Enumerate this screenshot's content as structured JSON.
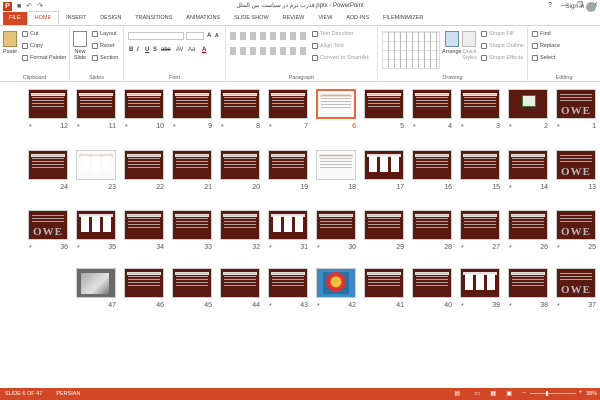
{
  "window": {
    "title": "قدرت نرم در سیاست بین الملل.pptx - PowerPoint",
    "min_glyph": "—",
    "restore_glyph": "❐",
    "close_glyph": "✕",
    "help_glyph": "?",
    "qat_undo": "↶",
    "qat_redo": "↷",
    "qat_save": "■"
  },
  "ribbon_tabs": [
    "FILE",
    "HOME",
    "INSERT",
    "DESIGN",
    "TRANSITIONS",
    "ANIMATIONS",
    "SLIDE SHOW",
    "REVIEW",
    "VIEW",
    "ADD-INS",
    "FILEminimizer"
  ],
  "active_tab": "HOME",
  "account": {
    "signin_label": "Sign in"
  },
  "clipboard": {
    "paste_label": "Paste",
    "cut_label": "Cut",
    "copy_label": "Copy",
    "painter_label": "Format Painter",
    "group_label": "Clipboard"
  },
  "slides_group": {
    "new_slide_label": "New\nSlide",
    "layout_label": "Layout",
    "reset_label": "Reset",
    "section_label": "Section",
    "group_label": "Slides"
  },
  "font_group": {
    "font_name": "",
    "font_size": "",
    "bold": "B",
    "italic": "I",
    "underline": "U",
    "shadow": "S",
    "strike": "abc",
    "spacing": "AV",
    "case": "Aa",
    "color": "A",
    "group_label": "Font"
  },
  "paragraph_group": {
    "text_direction_label": "Text Direction",
    "align_text_label": "Align Text",
    "smartart_label": "Convert to SmartArt",
    "group_label": "Paragraph"
  },
  "drawing_group": {
    "arrange_label": "Arrange",
    "quick_styles_label": "Quick\nStyles",
    "shape_fill_label": "Shape Fill",
    "shape_outline_label": "Shape Outline",
    "shape_effects_label": "Shape Effects",
    "group_label": "Drawing"
  },
  "editing_group": {
    "find_label": "Find",
    "replace_label": "Replace",
    "select_label": "Select",
    "group_label": "Editing"
  },
  "slides": [
    {
      "number": "1",
      "star": true,
      "kind": "title"
    },
    {
      "number": "2",
      "star": true,
      "kind": "logo"
    },
    {
      "number": "3",
      "star": true,
      "kind": "text"
    },
    {
      "number": "4",
      "star": true,
      "kind": "text"
    },
    {
      "number": "5",
      "star": false,
      "kind": "text"
    },
    {
      "number": "6",
      "star": false,
      "kind": "light",
      "selected": true
    },
    {
      "number": "7",
      "star": true,
      "kind": "text"
    },
    {
      "number": "8",
      "star": true,
      "kind": "text"
    },
    {
      "number": "9",
      "star": true,
      "kind": "text"
    },
    {
      "number": "10",
      "star": true,
      "kind": "text"
    },
    {
      "number": "11",
      "star": true,
      "kind": "text"
    },
    {
      "number": "12",
      "star": true,
      "kind": "text"
    },
    {
      "number": "13",
      "star": false,
      "kind": "owe"
    },
    {
      "number": "14",
      "star": true,
      "kind": "text"
    },
    {
      "number": "15",
      "star": false,
      "kind": "text"
    },
    {
      "number": "16",
      "star": false,
      "kind": "text"
    },
    {
      "number": "17",
      "star": false,
      "kind": "cards"
    },
    {
      "number": "18",
      "star": false,
      "kind": "light"
    },
    {
      "number": "19",
      "star": false,
      "kind": "text"
    },
    {
      "number": "20",
      "star": false,
      "kind": "text"
    },
    {
      "number": "21",
      "star": false,
      "kind": "text"
    },
    {
      "number": "22",
      "star": false,
      "kind": "text"
    },
    {
      "number": "23",
      "star": false,
      "kind": "lightcards"
    },
    {
      "number": "24",
      "star": false,
      "kind": "text"
    },
    {
      "number": "25",
      "star": true,
      "kind": "owe"
    },
    {
      "number": "26",
      "star": true,
      "kind": "text"
    },
    {
      "number": "27",
      "star": true,
      "kind": "text"
    },
    {
      "number": "28",
      "star": false,
      "kind": "text"
    },
    {
      "number": "29",
      "star": false,
      "kind": "text"
    },
    {
      "number": "30",
      "star": true,
      "kind": "text"
    },
    {
      "number": "31",
      "star": true,
      "kind": "cards"
    },
    {
      "number": "32",
      "star": false,
      "kind": "text"
    },
    {
      "number": "33",
      "star": false,
      "kind": "text"
    },
    {
      "number": "34",
      "star": false,
      "kind": "text"
    },
    {
      "number": "35",
      "star": true,
      "kind": "cards"
    },
    {
      "number": "36",
      "star": true,
      "kind": "owe"
    },
    {
      "number": "37",
      "star": true,
      "kind": "owe"
    },
    {
      "number": "38",
      "star": true,
      "kind": "text"
    },
    {
      "number": "39",
      "star": true,
      "kind": "cards"
    },
    {
      "number": "40",
      "star": false,
      "kind": "text"
    },
    {
      "number": "41",
      "star": false,
      "kind": "text"
    },
    {
      "number": "42",
      "star": true,
      "kind": "colorful"
    },
    {
      "number": "43",
      "star": true,
      "kind": "text"
    },
    {
      "number": "44",
      "star": false,
      "kind": "text"
    },
    {
      "number": "45",
      "star": false,
      "kind": "text"
    },
    {
      "number": "46",
      "star": false,
      "kind": "text"
    },
    {
      "number": "47",
      "star": false,
      "kind": "photo"
    }
  ],
  "owe_text": "OWE",
  "star_glyph": "*",
  "status": {
    "slide_info": "SLIDE 6 OF 47",
    "language": "PERSIAN",
    "zoom_level": "38%",
    "zoom_fraction": 0.38
  },
  "colors": {
    "accent": "#d24726",
    "slide_dark": "#5a1a12"
  }
}
